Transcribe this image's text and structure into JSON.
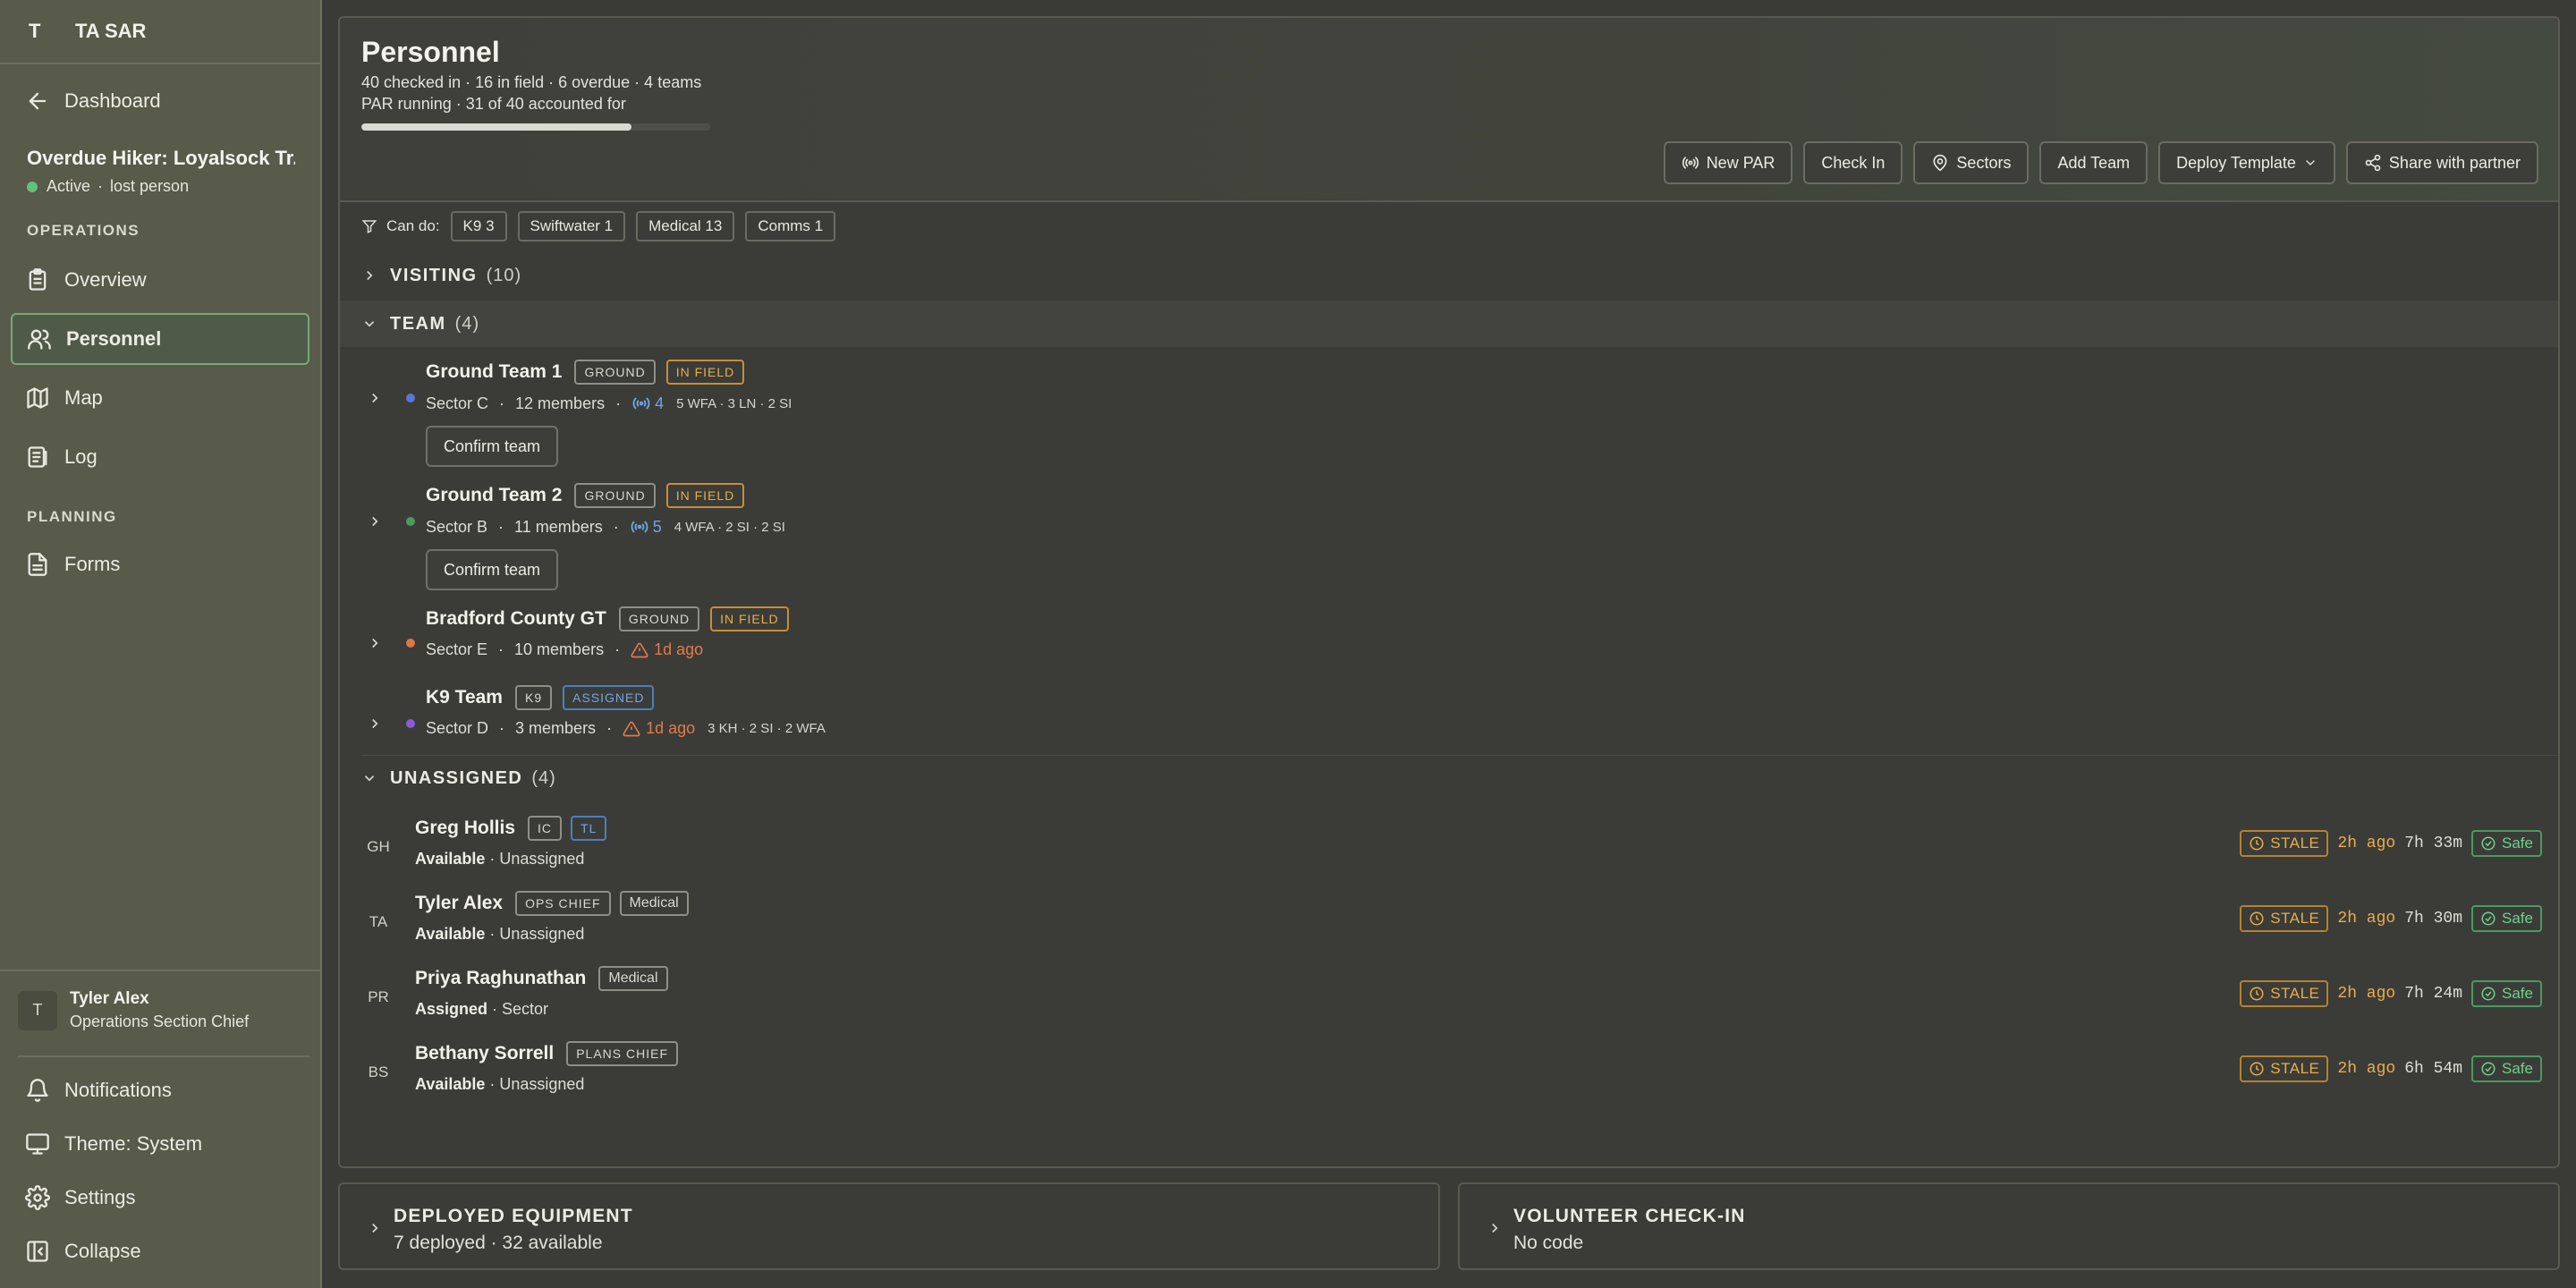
{
  "sidebar": {
    "logo": "T",
    "org_name": "TA SAR",
    "back_label": "Dashboard",
    "incident": {
      "title": "Overdue Hiker: Loyalsock Tr...",
      "status": "Active",
      "type": "lost person",
      "status_color": "#5fc27a"
    },
    "sections": {
      "operations": "OPERATIONS",
      "planning": "PLANNING"
    },
    "nav": {
      "overview": "Overview",
      "personnel": "Personnel",
      "map": "Map",
      "log": "Log",
      "forms": "Forms"
    },
    "user": {
      "initial": "T",
      "name": "Tyler Alex",
      "role": "Operations Section Chief"
    },
    "footer": {
      "notifications": "Notifications",
      "theme": "Theme: System",
      "settings": "Settings",
      "collapse": "Collapse"
    }
  },
  "header": {
    "title": "Personnel",
    "stats": "40 checked in · 16 in field · 6 overdue · 4 teams",
    "par_status": "PAR running · 31 of 40 accounted for",
    "par_progress": 0.775,
    "buttons": {
      "new_par": "New PAR",
      "check_in": "Check In",
      "sectors": "Sectors",
      "add_team": "Add Team",
      "deploy_template": "Deploy Template",
      "share": "Share with partner"
    }
  },
  "filter": {
    "label": "Can do:",
    "chips": [
      "K9 3",
      "Swiftwater 1",
      "Medical 13",
      "Comms 1"
    ]
  },
  "groups": {
    "visiting": {
      "name": "VISITING",
      "count": "(10)"
    },
    "team": {
      "name": "TEAM",
      "count": "(4)"
    },
    "unassigned": {
      "name": "UNASSIGNED",
      "count": "(4)"
    }
  },
  "teams": [
    {
      "name": "Ground Team 1",
      "type": "GROUND",
      "status": "IN FIELD",
      "sector": "Sector C",
      "members": "12 members",
      "radios": "4",
      "skills": "5 WFA · 3 LN · 2 SI",
      "confirm": "Confirm team",
      "color": "#5a76d6"
    },
    {
      "name": "Ground Team 2",
      "type": "GROUND",
      "status": "IN FIELD",
      "sector": "Sector B",
      "members": "11 members",
      "radios": "5",
      "skills": "4 WFA · 2 SI · 2 SI",
      "confirm": "Confirm team",
      "color": "#4f9a5c"
    },
    {
      "name": "Bradford County GT",
      "type": "GROUND",
      "status": "IN FIELD",
      "sector": "Sector E",
      "members": "10 members",
      "warning": "1d ago",
      "color": "#e0754a"
    },
    {
      "name": "K9 Team",
      "type": "K9",
      "status": "ASSIGNED",
      "sector": "Sector D",
      "members": "3 members",
      "warning": "1d ago",
      "skills": "3 KH · 2 SI · 2 WFA",
      "color": "#8b5ad6"
    }
  ],
  "people": [
    {
      "initials": "GH",
      "name": "Greg Hollis",
      "tags": [
        "IC",
        "TL"
      ],
      "availability": "Available",
      "assignment": "Unassigned",
      "stale": "STALE",
      "ago": "2h ago",
      "duration": "7h 33m",
      "safe": "Safe"
    },
    {
      "initials": "TA",
      "name": "Tyler Alex",
      "tags": [
        "OPS CHIEF",
        "Medical"
      ],
      "availability": "Available",
      "assignment": "Unassigned",
      "stale": "STALE",
      "ago": "2h ago",
      "duration": "7h 30m",
      "safe": "Safe"
    },
    {
      "initials": "PR",
      "name": "Priya Raghunathan",
      "tags": [
        "Medical"
      ],
      "availability": "Assigned",
      "assignment": "Sector",
      "stale": "STALE",
      "ago": "2h ago",
      "duration": "7h 24m",
      "safe": "Safe"
    },
    {
      "initials": "BS",
      "name": "Bethany Sorrell",
      "tags": [
        "PLANS CHIEF"
      ],
      "availability": "Available",
      "assignment": "Unassigned",
      "stale": "STALE",
      "ago": "2h ago",
      "duration": "6h 54m",
      "safe": "Safe"
    }
  ],
  "cards": {
    "equipment": {
      "title": "DEPLOYED EQUIPMENT",
      "sub": "7 deployed · 32 available"
    },
    "volunteer": {
      "title": "VOLUNTEER CHECK-IN",
      "sub": "No code"
    }
  },
  "icons": {
    "back": "arrow-left-icon",
    "overview": "clipboard-icon",
    "personnel": "users-icon",
    "map": "map-icon",
    "log": "log-icon",
    "forms": "file-icon",
    "notifications": "bell-icon",
    "theme": "monitor-icon",
    "settings": "gear-icon",
    "collapse": "sidebar-collapse-icon"
  }
}
